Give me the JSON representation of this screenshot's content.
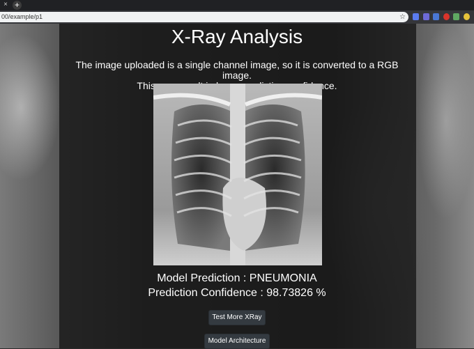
{
  "browser": {
    "url": "00/example/p1",
    "new_tab": "+",
    "close_tab": "×",
    "star": "☆"
  },
  "page": {
    "title": "X-Ray Analysis",
    "message_line1": "The image uploaded is a single channel image, so it is converted to a RGB image.",
    "message_line2": "This may result in lower prediction confidence.",
    "prediction": "Model Prediction : PNEUMONIA",
    "confidence": "Prediction Confidence : 98.73826 %",
    "buttons": {
      "test_more": "Test More XRay",
      "architecture": "Model Architecture"
    }
  }
}
